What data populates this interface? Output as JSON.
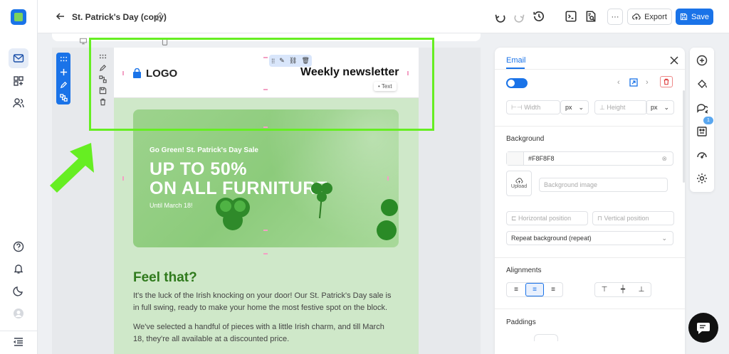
{
  "topbar": {
    "title": "St. Patrick's Day (copy)",
    "export_label": "Export",
    "save_label": "Save",
    "more_label": "···"
  },
  "email": {
    "logo_text": "LOGO",
    "newsletter_title": "Weekly newsletter",
    "text_chip": "Text",
    "hero": {
      "kicker": "Go Green! St. Patrick's Day Sale",
      "headline_1": "UP TO 50%",
      "headline_2": "ON ALL FURNITURE",
      "until": "Until March 18!"
    },
    "heading": "Feel that?",
    "paragraph_1": "It's the luck of the Irish knocking on your door! Our St. Patrick's Day sale is in full swing, ready to make your home the most festive spot on the block.",
    "paragraph_2": "We've selected a handful of pieces with a little Irish charm, and till March 18, they're all available at a discounted price."
  },
  "panel": {
    "tab": "Email",
    "width_placeholder": "Width",
    "height_placeholder": "Height",
    "unit_w": "px",
    "unit_h": "px",
    "background_label": "Background",
    "background_color": "#F8F8F8",
    "upload_label": "Upload",
    "bg_image_placeholder": "Background image",
    "h_pos_placeholder": "Horizontal position",
    "v_pos_placeholder": "Vertical position",
    "repeat_value": "Repeat background (repeat)",
    "alignments_label": "Alignments",
    "paddings_label": "Paddings"
  },
  "right_toolbar": {
    "badge_count": "1"
  },
  "colors": {
    "accent": "#1a73e8",
    "selection": "#66ee22",
    "heading_green": "#2f7a1c",
    "delete_red": "#d33333"
  }
}
